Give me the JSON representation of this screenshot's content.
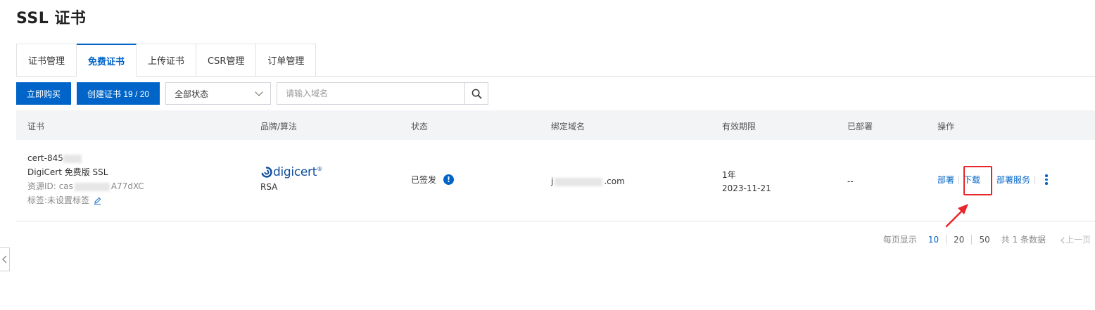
{
  "page": {
    "title": "SSL 证书"
  },
  "tabs": [
    {
      "label": "证书管理",
      "active": false
    },
    {
      "label": "免费证书",
      "active": true
    },
    {
      "label": "上传证书",
      "active": false
    },
    {
      "label": "CSR管理",
      "active": false
    },
    {
      "label": "订单管理",
      "active": false
    }
  ],
  "toolbar": {
    "buy_label": "立即购买",
    "create_label": "创建证书 19 / 20",
    "status_select": "全部状态",
    "search_placeholder": "请输入域名"
  },
  "table": {
    "columns": [
      "证书",
      "品牌/算法",
      "状态",
      "绑定域名",
      "有效期限",
      "已部署",
      "操作"
    ],
    "row": {
      "cert_name_prefix": "cert-845",
      "cert_type": "DigiCert 免费版 SSL",
      "resource_id_prefix": "资源ID: cas",
      "resource_id_suffix": "A77dXC",
      "tags": "标签:未设置标签",
      "brand_logo_text": "digicert",
      "algorithm": "RSA",
      "status": "已签发",
      "domain_prefix": "j",
      "domain_suffix": ".com",
      "validity_period": "1年",
      "validity_date": "2023-11-21",
      "deployed": "--",
      "actions": {
        "deploy": "部署",
        "download": "下载",
        "deploy_service": "部署服务"
      }
    }
  },
  "pagination": {
    "per_page_label": "每页显示",
    "sizes": [
      "10",
      "20",
      "50"
    ],
    "selected_size": "10",
    "total": "共 1 条数据",
    "prev": "上一页"
  },
  "colors": {
    "primary": "#0064c8",
    "highlight": "#e8262b"
  }
}
